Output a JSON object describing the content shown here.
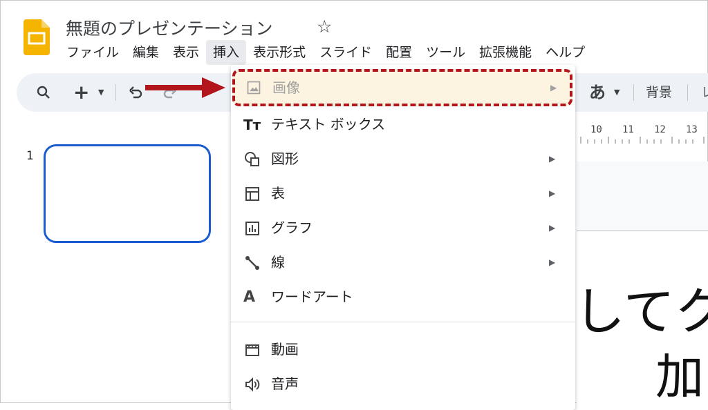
{
  "app": {
    "title": "無題のプレゼンテーション",
    "star_icon": "star-icon"
  },
  "menubar": [
    "ファイル",
    "編集",
    "表示",
    "挿入",
    "表示形式",
    "スライド",
    "配置",
    "ツール",
    "拡張機能",
    "ヘルプ"
  ],
  "menubar_active": "挿入",
  "toolbar": {
    "font_label": "あ",
    "background_label": "背景",
    "last_label": "レ"
  },
  "ruler": [
    "10",
    "11",
    "12",
    "13"
  ],
  "slide_panel": {
    "slide_number": "1"
  },
  "slide_text": {
    "line1": "してク",
    "line2": "加"
  },
  "insert_menu": {
    "items": [
      {
        "label": "画像",
        "icon": "image-icon",
        "submenu": true,
        "disabled": true
      },
      {
        "label": "テキスト ボックス",
        "icon": "textbox-icon",
        "submenu": false
      },
      {
        "label": "図形",
        "icon": "shape-icon",
        "submenu": true
      },
      {
        "label": "表",
        "icon": "table-icon",
        "submenu": true
      },
      {
        "label": "グラフ",
        "icon": "chart-icon",
        "submenu": true
      },
      {
        "label": "線",
        "icon": "line-icon",
        "submenu": true
      },
      {
        "label": "ワードアート",
        "icon": "wordart-icon",
        "submenu": false
      },
      {
        "label": "動画",
        "icon": "video-icon",
        "submenu": false
      },
      {
        "label": "音声",
        "icon": "audio-icon",
        "submenu": false
      }
    ]
  },
  "colors": {
    "highlight": "#b2151b",
    "selection": "#1a5ccf",
    "logo": "#f4b400"
  }
}
